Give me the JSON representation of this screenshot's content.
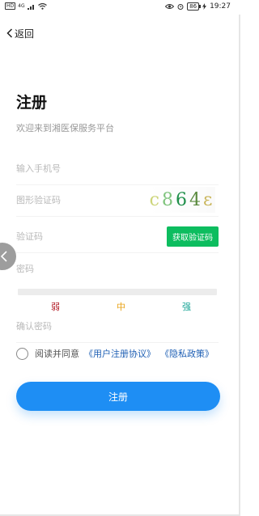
{
  "status_bar": {
    "left_badge": "HD",
    "signal_text": "4G",
    "battery": "86",
    "time": "19:27"
  },
  "nav": {
    "back_label": "返回"
  },
  "title": "注册",
  "subtitle": "欢迎来到湘医保服务平台",
  "form": {
    "phone_placeholder": "输入手机号",
    "captcha_placeholder": "图形验证码",
    "captcha_chars": [
      "c",
      "8",
      "6",
      "4",
      "ɛ"
    ],
    "sms_code_placeholder": "验证码",
    "sms_button_label": "获取验证码",
    "password_placeholder": "密码",
    "strength_labels": [
      "弱",
      "中",
      "强"
    ],
    "confirm_password_placeholder": "确认密码"
  },
  "agreement": {
    "prefix": "阅读并同意",
    "user_agreement": "《用户注册协议》",
    "privacy_policy": "《隐私政策》"
  },
  "submit_label": "注册",
  "colors": {
    "primary": "#1e8ef4",
    "sms_button": "#0dbd5f",
    "weak": "#b4202a",
    "medium": "#e8a317",
    "strong": "#1aa597"
  }
}
